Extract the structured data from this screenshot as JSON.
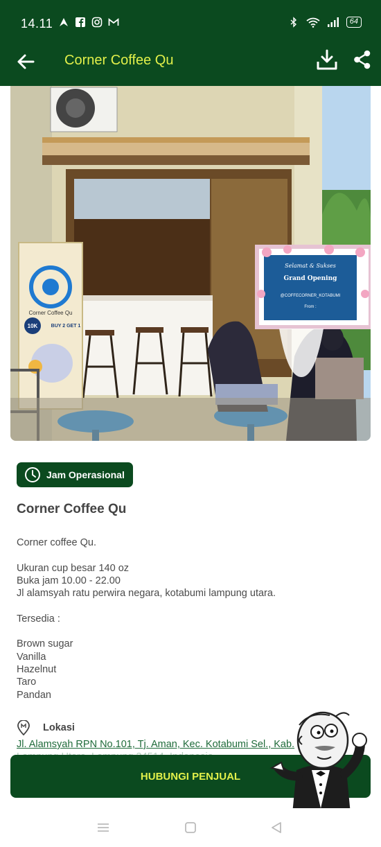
{
  "status_bar": {
    "time": "14.11",
    "battery": "64",
    "icons_left": [
      "navigation-icon",
      "facebook-icon",
      "instagram-icon",
      "gmail-icon"
    ],
    "icons_right": [
      "bluetooth-icon",
      "wifi-icon",
      "signal-icon",
      "battery-icon"
    ]
  },
  "app_bar": {
    "title": "Corner Coffee Qu",
    "actions": [
      "download-icon",
      "share-icon"
    ]
  },
  "hero": {
    "banner_brand": "Corner Coffee Qu",
    "banner_price": "10K",
    "banner_promo": "BUY 2 GET 1",
    "board_line1": "Selamat & Sukses",
    "board_line2": "Grand Opening",
    "board_line3": "@COFFECORNER_KOTABUMI",
    "board_line4": "From :"
  },
  "badge": {
    "label": "Jam Operasional"
  },
  "shop": {
    "title": "Corner Coffee Qu"
  },
  "description": [
    "Corner coffee Qu.",
    "",
    "Ukuran cup besar 140 oz",
    "Buka jam 10.00 - 22.00",
    "Jl alamsyah ratu perwira negara, kotabumi lampung utara.",
    "",
    "Tersedia :",
    "",
    "Brown sugar",
    "Vanilla",
    "Hazelnut",
    "Taro",
    "Pandan"
  ],
  "location": {
    "label": "Lokasi",
    "address": "Jl. Alamsyah RPN No.101, Tj. Aman, Kec. Kotabumi Sel., Kab.",
    "address_cont": "Lampung Utara, Lampung 34514, Indonesia"
  },
  "cta": {
    "label": "HUBUNGI PENJUAL"
  },
  "colors": {
    "primary": "#0b4a1f",
    "accent": "#e2f04a",
    "link": "#1f6b3a"
  }
}
